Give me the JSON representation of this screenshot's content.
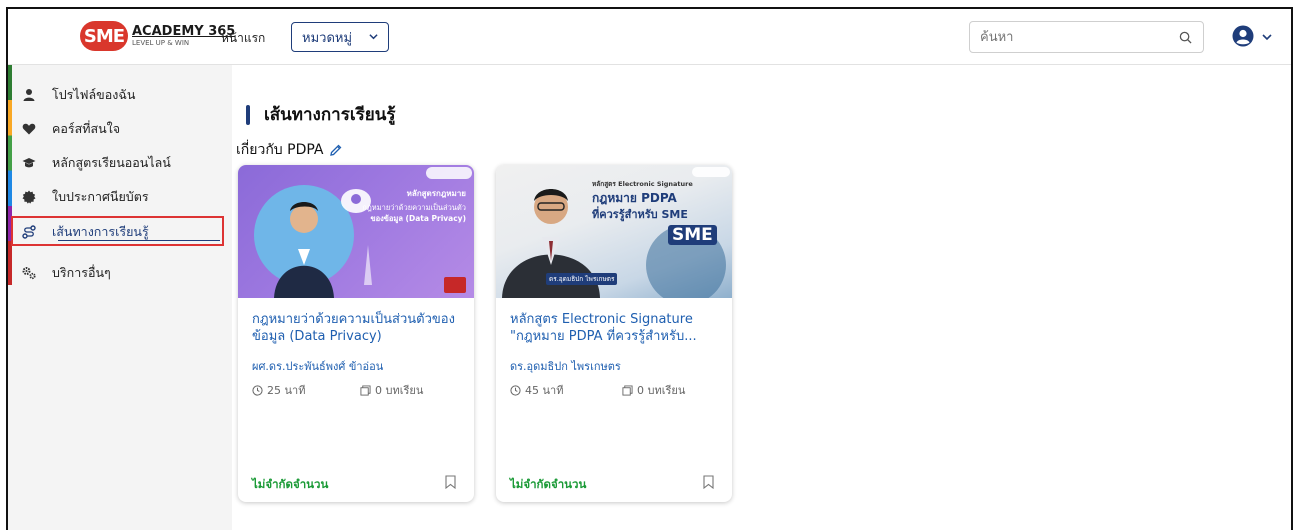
{
  "header": {
    "logo_title": "ACADEMY 365",
    "logo_tagline": "LEVEL UP & WIN",
    "logo_badge": "SME",
    "home_link": "หน้าแรก",
    "category_button": "หมวดหมู่",
    "search_placeholder": "ค้นหา"
  },
  "sidebar": {
    "items": [
      {
        "label": "โปรไฟล์ของฉัน",
        "icon": "user-icon"
      },
      {
        "label": "คอร์สที่สนใจ",
        "icon": "heart-icon"
      },
      {
        "label": "หลักสูตรเรียนออนไลน์",
        "icon": "graduation-cap-icon"
      },
      {
        "label": "ใบประกาศนียบัตร",
        "icon": "certificate-icon"
      },
      {
        "label": "เส้นทางการเรียนรู้",
        "icon": "route-icon",
        "active": true
      },
      {
        "label": "บริการอื่นๆ",
        "icon": "cogs-icon"
      }
    ],
    "stripe_colors": [
      "#2e7d32",
      "#f9a825",
      "#43a047",
      "#1e88e5",
      "#8e24aa",
      "#c62828"
    ]
  },
  "main": {
    "page_title": "เส้นทางการเรียนรู้",
    "subtitle": "เกี่ยวกับ PDPA"
  },
  "courses": [
    {
      "title": "กฎหมายว่าด้วยความเป็นส่วนตัวของข้อมูล (Data Privacy)",
      "author": "ผศ.ดร.ประพันธ์พงศ์ ข้าอ่อน",
      "duration": "25 นาที",
      "lessons": "0 บทเรียน",
      "price": "ไม่จำกัดจำนวน",
      "thumb": {
        "heading": "หลักสูตรกฎหมาย",
        "line1": "กฎหมายว่าด้วยความเป็นส่วนตัว",
        "line2": "ของข้อมูล (Data Privacy)"
      }
    },
    {
      "title": "หลักสูตร Electronic Signature \"กฎหมาย PDPA ที่ควรรู้สำหรับ...",
      "author": "ดร.อุดมธิปก ไพรเกษตร",
      "duration": "45 นาที",
      "lessons": "0 บทเรียน",
      "price": "ไม่จำกัดจำนวน",
      "thumb": {
        "heading": "หลักสูตร Electronic Signature",
        "line1": "กฎหมาย PDPA",
        "line2": "ที่ควรรู้สำหรับ SME",
        "badge": "SME",
        "name_tag": "ดร.อุดมธิปก ไพรเกษตร"
      }
    }
  ],
  "colors": {
    "accent": "#1f3d7a",
    "link": "#1f5fb0",
    "price_green": "#1a9a36",
    "highlight_red": "#d33333"
  }
}
